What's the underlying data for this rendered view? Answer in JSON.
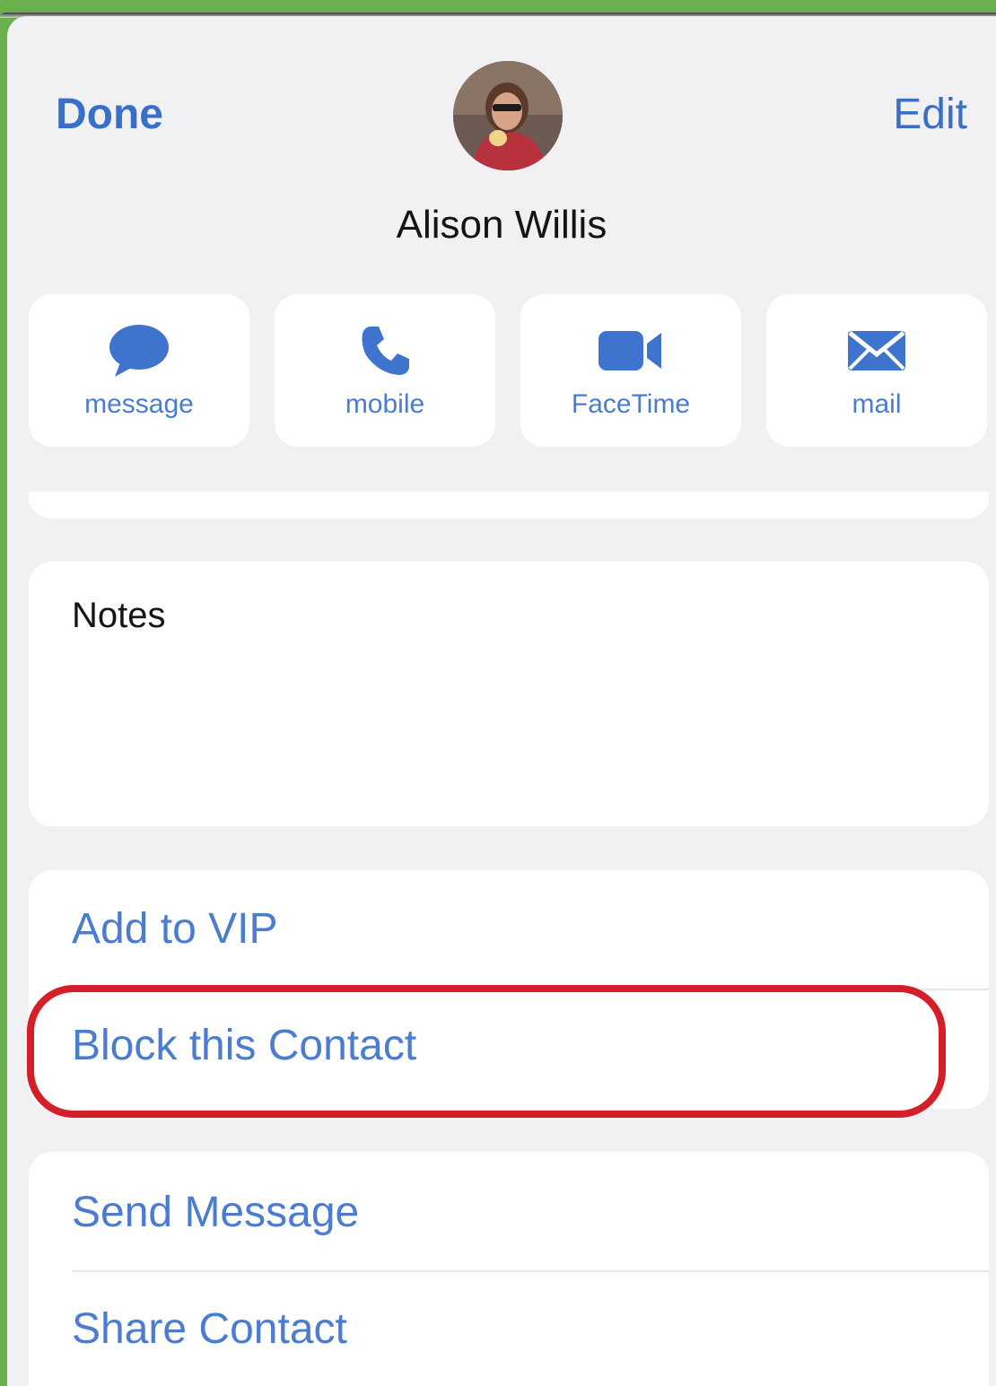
{
  "header": {
    "done_label": "Done",
    "edit_label": "Edit",
    "contact_name": "Alison Willis"
  },
  "actions": [
    {
      "label": "message",
      "icon": "message-bubble-icon"
    },
    {
      "label": "mobile",
      "icon": "phone-icon"
    },
    {
      "label": "FaceTime",
      "icon": "video-camera-icon"
    },
    {
      "label": "mail",
      "icon": "envelope-icon"
    }
  ],
  "notes": {
    "title": "Notes"
  },
  "options_group1": {
    "add_vip": "Add to VIP",
    "block_contact": "Block this Contact"
  },
  "options_group2": {
    "send_message": "Send Message",
    "share_contact": "Share Contact"
  },
  "colors": {
    "accent": "#4a7ccf",
    "highlight": "#d41f2a",
    "frame": "#6ab04c"
  }
}
